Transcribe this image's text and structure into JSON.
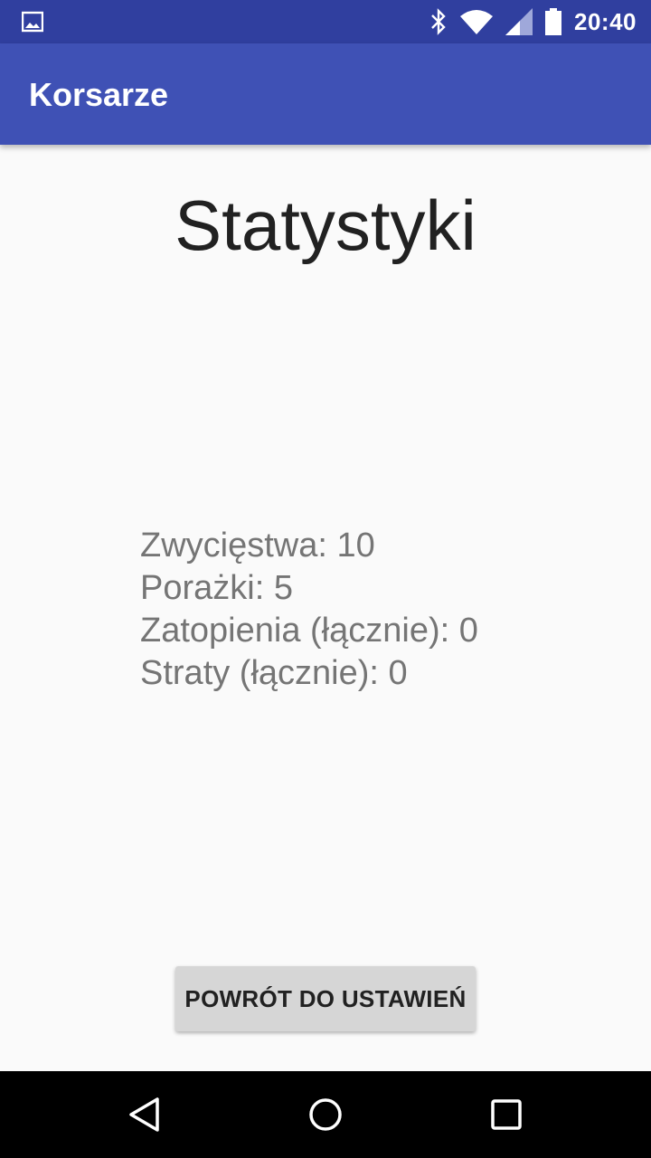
{
  "status_bar": {
    "time": "20:40",
    "icons": [
      "image-notification-icon",
      "bluetooth-icon",
      "wifi-icon",
      "signal-icon",
      "battery-icon"
    ]
  },
  "app_bar": {
    "title": "Korsarze"
  },
  "page": {
    "title": "Statystyki",
    "stats": [
      "Zwycięstwa: 10",
      "Porażki: 5",
      "Zatopienia (łącznie): 0",
      "Straty (łącznie): 0"
    ],
    "back_button_label": "POWRÓT DO USTAWIEŃ"
  },
  "nav_bar": {
    "icons": [
      "back-icon",
      "home-icon",
      "recents-icon"
    ]
  },
  "colors": {
    "status_bar": "#303f9f",
    "app_bar": "#3f51b5",
    "background": "#fafafa",
    "button": "#d6d6d6"
  }
}
